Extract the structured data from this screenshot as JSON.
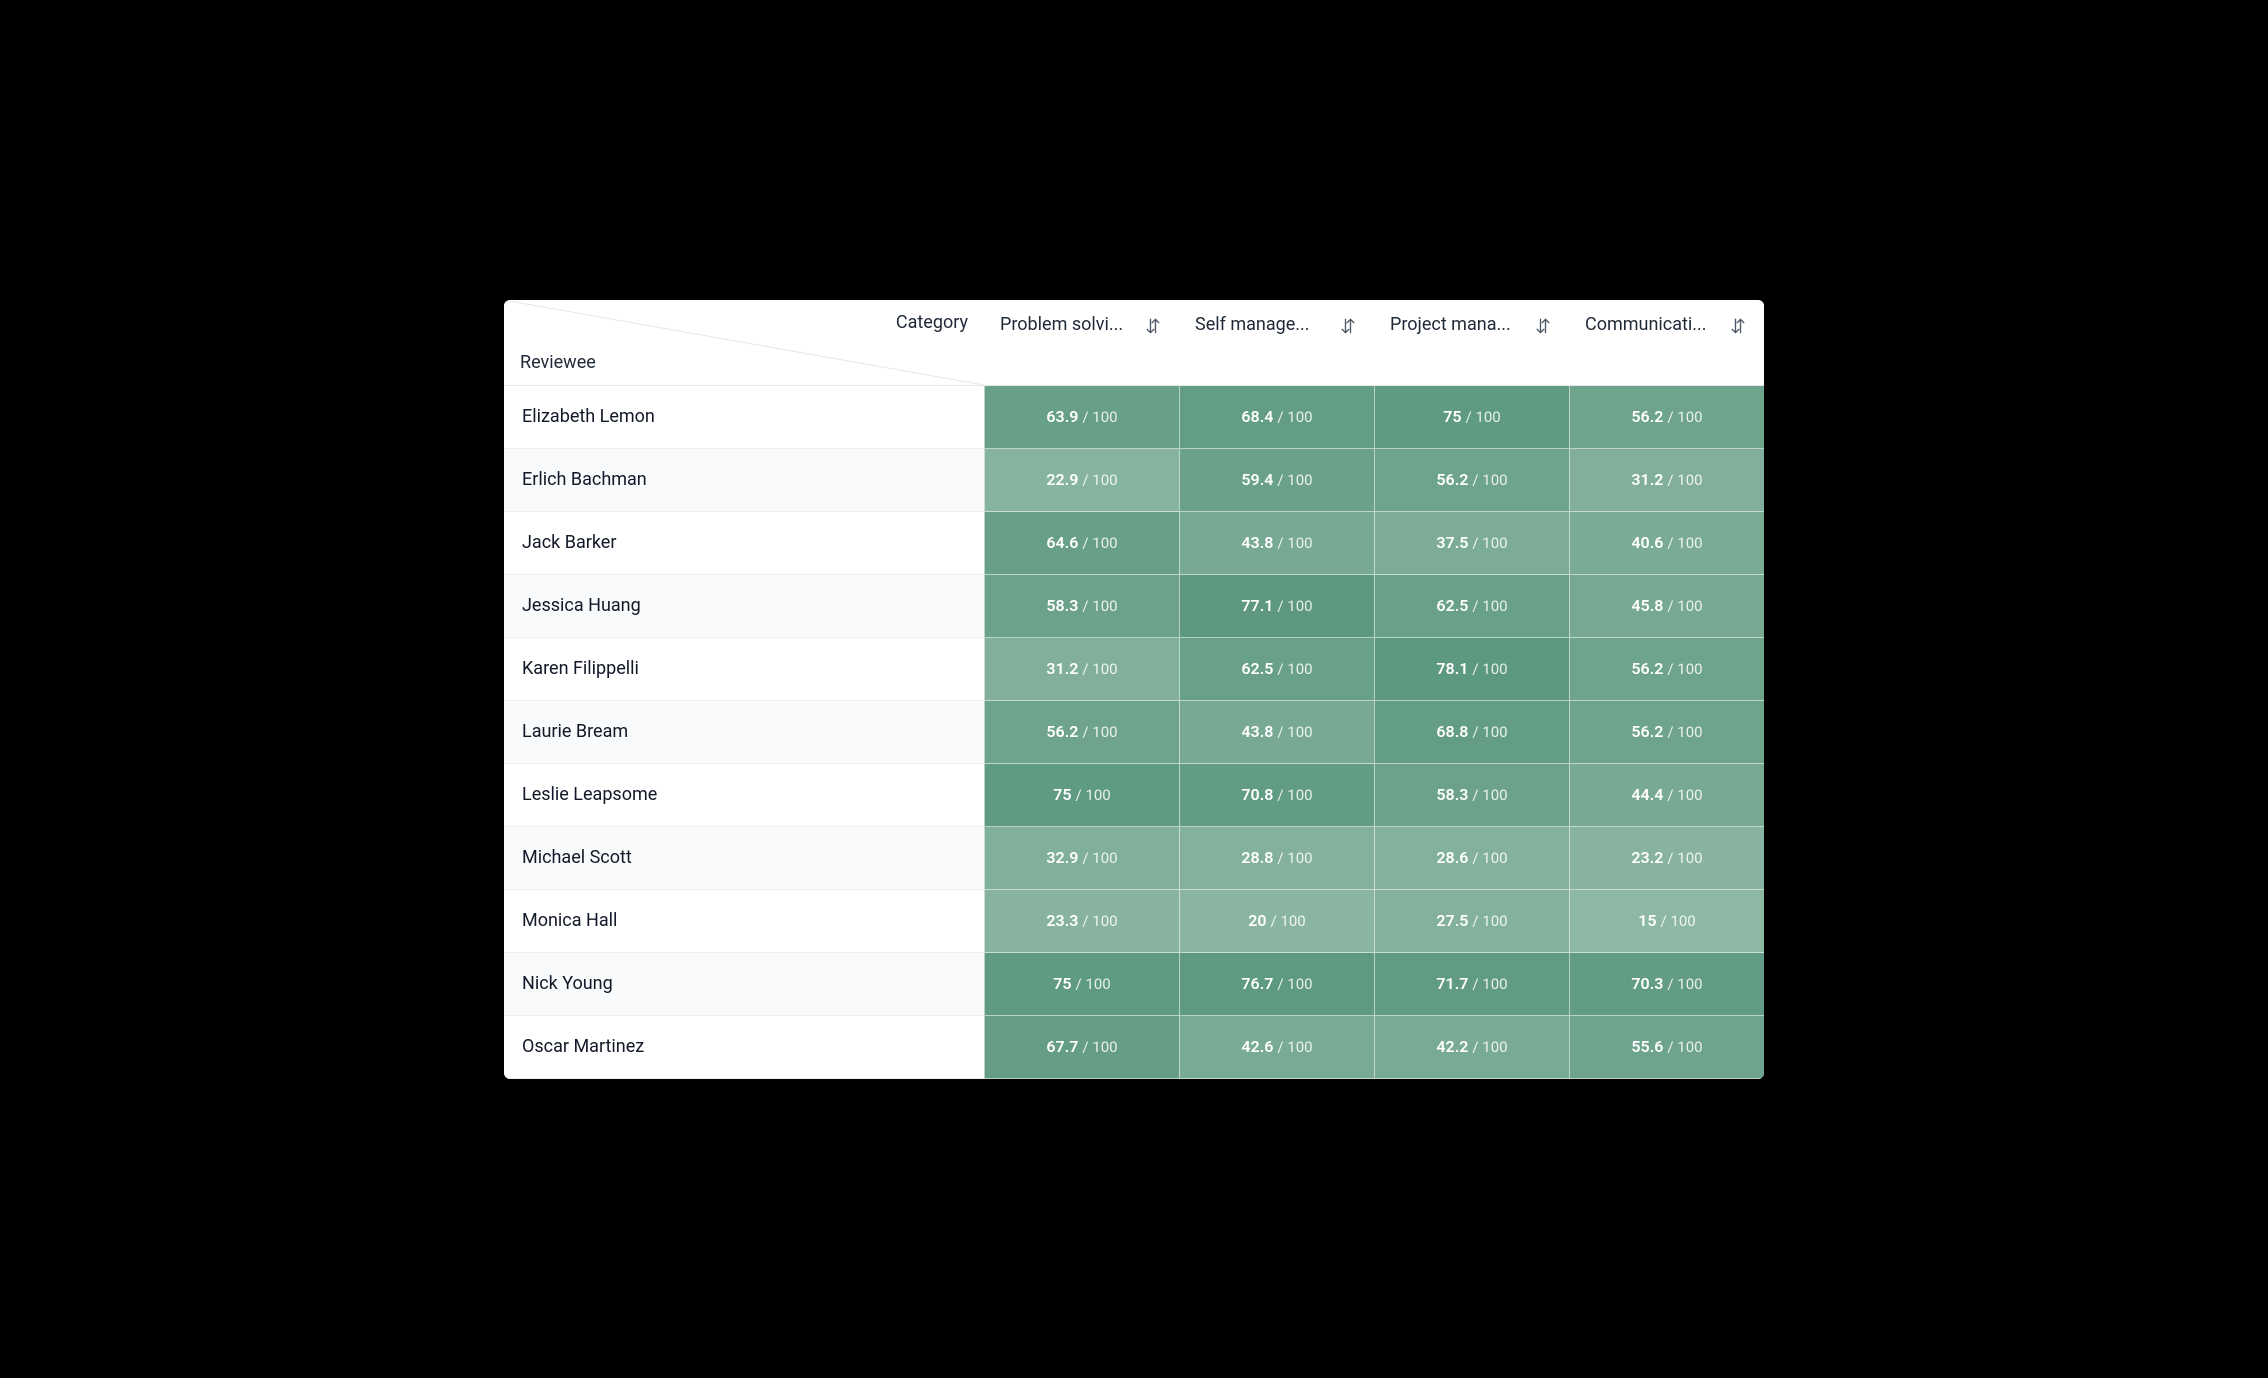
{
  "header": {
    "corner_top": "Category",
    "corner_bottom": "Reviewee",
    "columns": [
      "Problem solvi...",
      "Self manage...",
      "Project mana...",
      "Communicati..."
    ],
    "denominator_label": "/ 100",
    "max_score": 100
  },
  "rows": [
    {
      "name": "Elizabeth Lemon",
      "scores": [
        63.9,
        68.4,
        75,
        56.2
      ]
    },
    {
      "name": "Erlich Bachman",
      "scores": [
        22.9,
        59.4,
        56.2,
        31.2
      ]
    },
    {
      "name": "Jack Barker",
      "scores": [
        64.6,
        43.8,
        37.5,
        40.6
      ]
    },
    {
      "name": "Jessica Huang",
      "scores": [
        58.3,
        77.1,
        62.5,
        45.8
      ]
    },
    {
      "name": "Karen Filippelli",
      "scores": [
        31.2,
        62.5,
        78.1,
        56.2
      ]
    },
    {
      "name": "Laurie Bream",
      "scores": [
        56.2,
        43.8,
        68.8,
        56.2
      ]
    },
    {
      "name": "Leslie Leapsome",
      "scores": [
        75,
        70.8,
        58.3,
        44.4
      ]
    },
    {
      "name": "Michael Scott",
      "scores": [
        32.9,
        28.8,
        28.6,
        23.2
      ]
    },
    {
      "name": "Monica Hall",
      "scores": [
        23.3,
        20,
        27.5,
        15
      ]
    },
    {
      "name": "Nick Young",
      "scores": [
        75,
        76.7,
        71.7,
        70.3
      ]
    },
    {
      "name": "Oscar Martinez",
      "scores": [
        67.7,
        42.6,
        42.2,
        55.6
      ]
    }
  ]
}
